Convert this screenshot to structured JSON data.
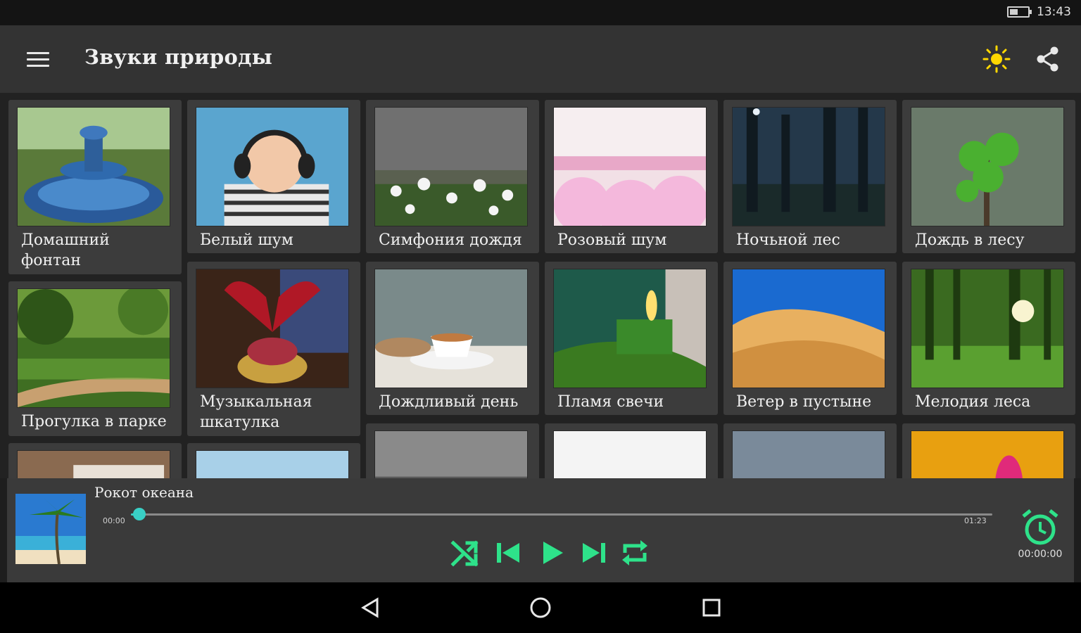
{
  "status": {
    "time": "13:43"
  },
  "app": {
    "title": "Звуки природы"
  },
  "colors": {
    "accent": "#39d0c6",
    "control_green": "#2ee28a",
    "sun": "#ffd800"
  },
  "tiles": [
    {
      "label": "Домашний\nфонтан",
      "icon": "fountain-image"
    },
    {
      "label": "Белый шум",
      "icon": "baby-headphones-image"
    },
    {
      "label": "Симфония дождя",
      "icon": "rain-flowers-image"
    },
    {
      "label": "Розовый шум",
      "icon": "pink-clouds-image"
    },
    {
      "label": "Ночьной лес",
      "icon": "night-forest-image"
    },
    {
      "label": "Дождь в лесу",
      "icon": "forest-rain-image"
    },
    {
      "label": "Прогулка в парке",
      "icon": "park-path-image"
    },
    {
      "label": "Музыкальная\nшкатулка",
      "icon": "music-box-image"
    },
    {
      "label": "Дождливый день",
      "icon": "tea-cup-window-image"
    },
    {
      "label": "Пламя свечи",
      "icon": "candle-image"
    },
    {
      "label": "Ветер в пустыне",
      "icon": "desert-dunes-image"
    },
    {
      "label": "Мелодия леса",
      "icon": "sunny-forest-image"
    },
    {
      "label": "",
      "icon": "room-image"
    },
    {
      "label": "",
      "icon": "sea-image"
    },
    {
      "label": "",
      "icon": "rain-street-image"
    },
    {
      "label": "",
      "icon": "red-hearts-image"
    },
    {
      "label": "",
      "icon": "sheep-image"
    },
    {
      "label": "",
      "icon": "autumn-child-image"
    }
  ],
  "player": {
    "track_title": "Рокот океана",
    "current_time": "00:00",
    "total_time": "01:23",
    "progress": 0.01,
    "timer": "00:00:00"
  }
}
